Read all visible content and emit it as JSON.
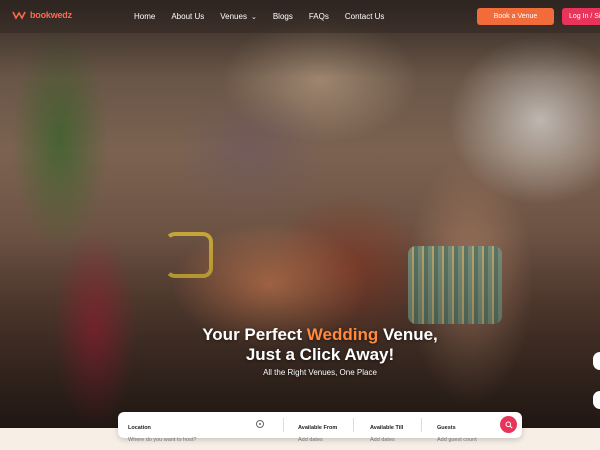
{
  "brand": {
    "name": "bookwedz"
  },
  "nav": {
    "links": [
      "Home",
      "About Us",
      "Venues",
      "Blogs",
      "FAQs",
      "Contact Us"
    ],
    "book_venue": "Book a Venue",
    "login": "Log In / Sign Up"
  },
  "hero": {
    "headline_pre": "Your Perfect ",
    "headline_accent": "Wedding",
    "headline_post": " Venue,",
    "headline_line2": "Just a Click Away!",
    "subtitle": "All the Right Venues, One Place"
  },
  "search": {
    "location_label": "Location",
    "location_placeholder": "Where do you want to host?",
    "from_label": "Available From",
    "from_placeholder": "Add dates",
    "till_label": "Available Till",
    "till_placeholder": "Add dates",
    "guests_label": "Guests",
    "guests_placeholder": "Add guest count"
  },
  "colors": {
    "accent": "#ff8a3d",
    "book_button": "#f26b3a",
    "login_button": "#e8345a"
  },
  "icons": [
    "logo-mark-icon",
    "chevron-down-icon",
    "location-icon",
    "search-icon"
  ]
}
